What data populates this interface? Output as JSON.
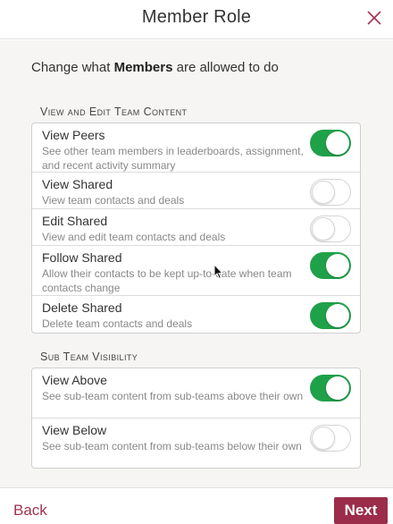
{
  "header": {
    "title": "Member Role"
  },
  "intro": {
    "prefix": "Change what ",
    "role": "Members",
    "suffix": " are allowed to do"
  },
  "sections": [
    {
      "title": "View and Edit Team Content",
      "items": [
        {
          "label": "View Peers",
          "desc": "See other team members in leaderboards, assignment, and recent activity summary",
          "on": true
        },
        {
          "label": "View Shared",
          "desc": "View team contacts and deals",
          "on": false
        },
        {
          "label": "Edit Shared",
          "desc": "View and edit team contacts and deals",
          "on": false
        },
        {
          "label": "Follow Shared",
          "desc": "Allow their contacts to be kept up-to-date when team contacts change",
          "on": true
        },
        {
          "label": "Delete Shared",
          "desc": "Delete team contacts and deals",
          "on": true
        }
      ]
    },
    {
      "title": "Sub Team Visibility",
      "items": [
        {
          "label": "View Above",
          "desc": "See sub-team content from sub-teams above their own",
          "on": true
        },
        {
          "label": "View Below",
          "desc": "See sub-team content from sub-teams below their own",
          "on": false
        }
      ]
    }
  ],
  "footer": {
    "back_label": "Back",
    "next_label": "Next"
  },
  "colors": {
    "accent": "#9b2d4a",
    "toggle_on": "#1fa14a"
  }
}
